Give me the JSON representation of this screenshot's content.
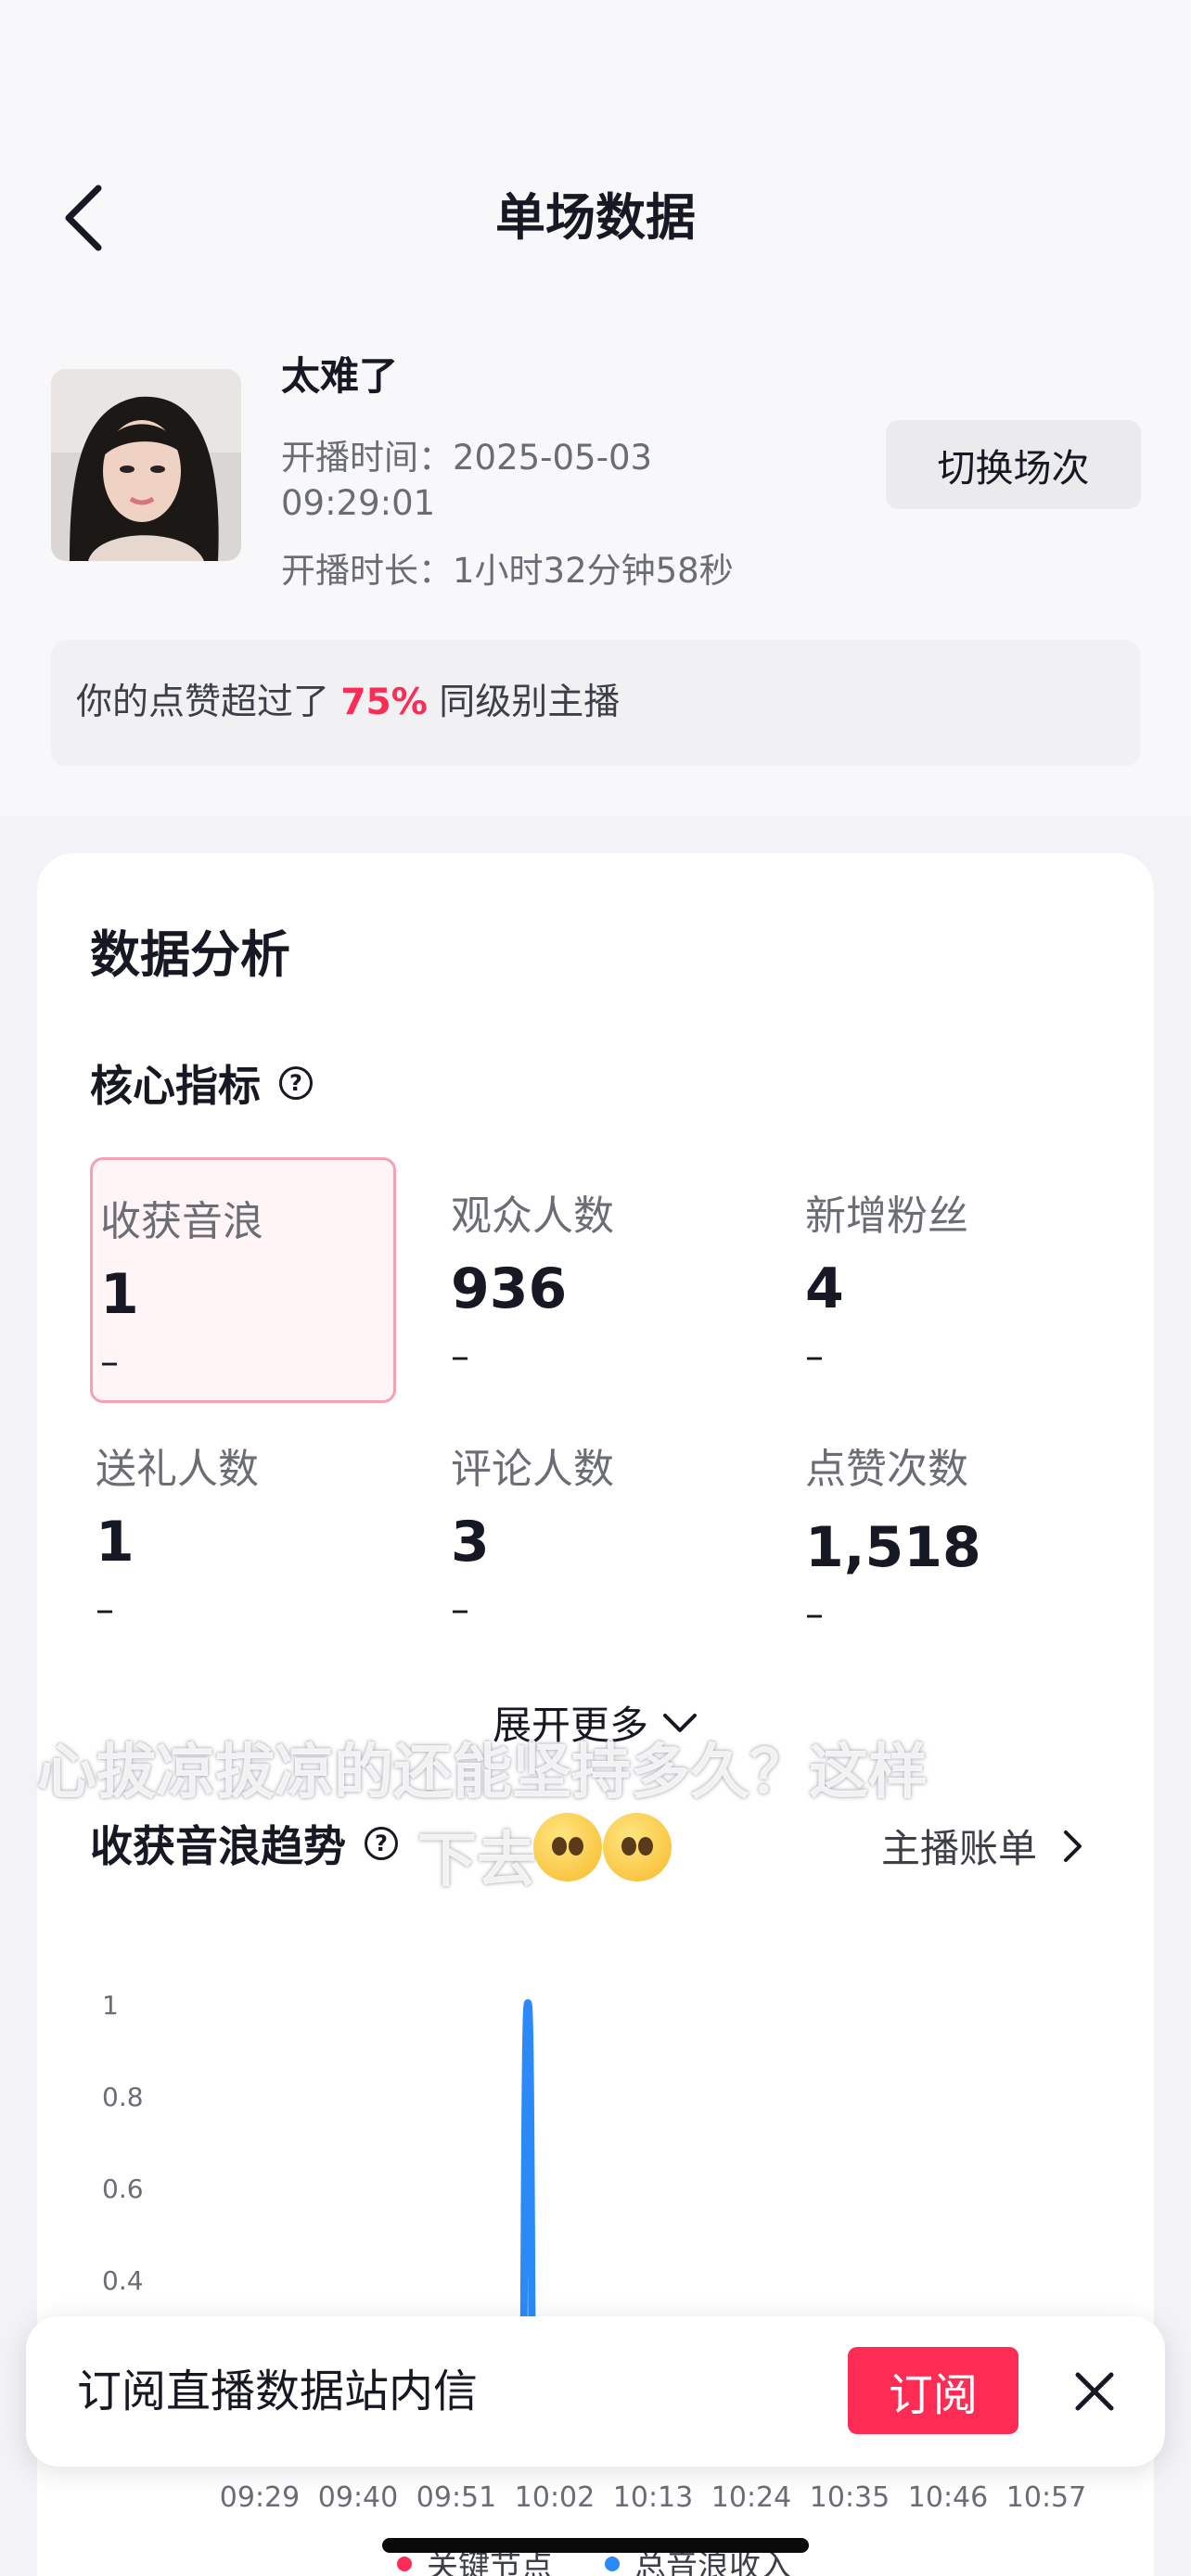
{
  "header": {
    "title": "单场数据"
  },
  "session": {
    "streamer_name": "太难了",
    "start_time_label": "开播时间：",
    "start_time_value_line1": "2025-05-03",
    "start_time_value_line2": "09:29:01",
    "duration_label": "开播时长：",
    "duration_value": "1小时32分钟58秒",
    "switch_button": "切换场次"
  },
  "compare": {
    "prefix": "你的点赞超过了",
    "percent": "75%",
    "suffix": "同级别主播"
  },
  "analysis": {
    "title": "数据分析",
    "core_title": "核心指标",
    "help_glyph": "?",
    "metrics": [
      {
        "label": "收获音浪",
        "value": "1",
        "delta": "–"
      },
      {
        "label": "观众人数",
        "value": "936",
        "delta": "–"
      },
      {
        "label": "新增粉丝",
        "value": "4",
        "delta": "–"
      },
      {
        "label": "送礼人数",
        "value": "1",
        "delta": "–"
      },
      {
        "label": "评论人数",
        "value": "3",
        "delta": "–"
      },
      {
        "label": "点赞次数",
        "value": "1,518",
        "delta": "–"
      }
    ],
    "expand_more": "展开更多"
  },
  "overlay_caption": {
    "line1": "心拔凉拔凉的还能坚持多久？这样",
    "line2": "下去"
  },
  "trend": {
    "title": "收获音浪趋势",
    "anchor_bill": "主播账单"
  },
  "chart_data": {
    "type": "line",
    "title": "收获音浪趋势",
    "xlabel": "",
    "ylabel": "",
    "yticks": [
      "1",
      "0.8",
      "0.6",
      "0.4"
    ],
    "ylim": [
      0,
      1
    ],
    "xticks": [
      "09:29",
      "09:40",
      "09:51",
      "10:02",
      "10:13",
      "10:24",
      "10:35",
      "10:46",
      "10:57"
    ],
    "series": [
      {
        "name": "总音浪收入",
        "color": "#2b8af7",
        "x": [
          "09:59"
        ],
        "y": [
          1
        ]
      }
    ],
    "legend": [
      "关键节点",
      "总音浪收入"
    ],
    "legend_colors": [
      "#fe2c55",
      "#2b8af7"
    ]
  },
  "subscribe": {
    "text": "订阅直播数据站内信",
    "button": "订阅"
  },
  "colors": {
    "accent": "#fe2c55",
    "chart_line": "#2b8af7",
    "selected_border": "#f5a1b3"
  }
}
